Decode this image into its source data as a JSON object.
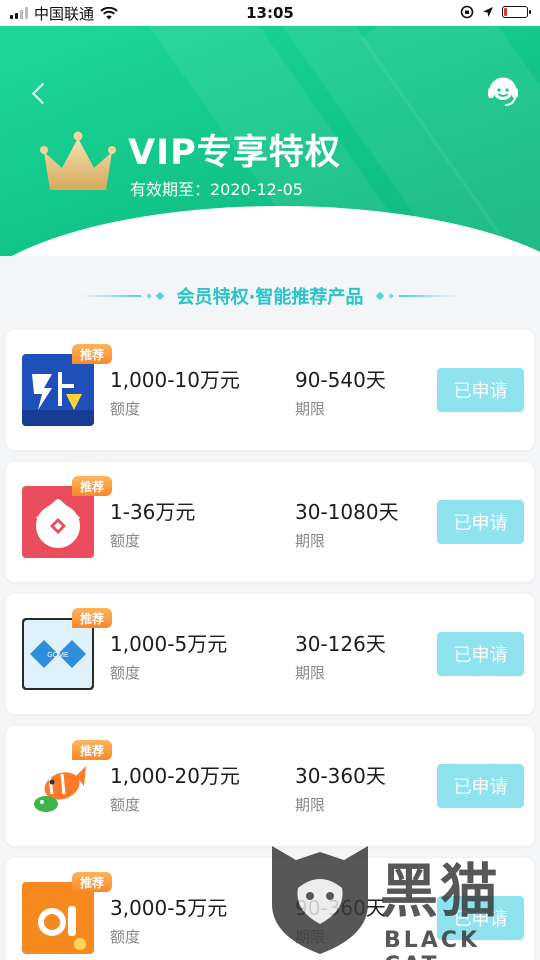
{
  "status_bar": {
    "carrier": "中国联通",
    "time": "13:05",
    "battery_level": 0.15,
    "battery_color": "#e33333"
  },
  "header": {
    "title": "VIP专享特权",
    "expire_text": "有效期至：2020-12-05",
    "background_color": "#13c98a",
    "back_icon": "chevron-left-icon",
    "service_icon": "customer-service-headset-icon",
    "crown_icon": "crown-icon"
  },
  "section": {
    "title": "会员特权·智能推荐产品",
    "color": "#27c4c8"
  },
  "products": [
    {
      "tag": "推荐",
      "logo": "lightning-loan-logo",
      "amount": "1,000-10万元",
      "amount_label": "额度",
      "term": "90-540天",
      "term_label": "期限",
      "button_label": "已申请"
    },
    {
      "tag": "推荐",
      "logo": "house-loan-logo",
      "amount": "1-36万元",
      "amount_label": "额度",
      "term": "30-1080天",
      "term_label": "期限",
      "button_label": "已申请"
    },
    {
      "tag": "推荐",
      "logo": "gome-finance-logo",
      "logo_text": "GOME",
      "amount": "1,000-5万元",
      "amount_label": "额度",
      "term": "30-126天",
      "term_label": "期限",
      "button_label": "已申请"
    },
    {
      "tag": "推荐",
      "logo": "fish-logo",
      "amount": "1,000-20万元",
      "amount_label": "额度",
      "term": "30-360天",
      "term_label": "期限",
      "button_label": "已申请"
    },
    {
      "tag": "推荐",
      "logo": "orange-loan-logo",
      "amount": "3,000-5万元",
      "amount_label": "额度",
      "term": "90-360天",
      "term_label": "期限",
      "button_label": "已申请"
    }
  ],
  "colors": {
    "button_disabled": "#8fe3ef",
    "tag_orange": "#f7892b"
  },
  "watermark": {
    "text_cn": "黑猫",
    "text_en": "BLACK CAT"
  }
}
